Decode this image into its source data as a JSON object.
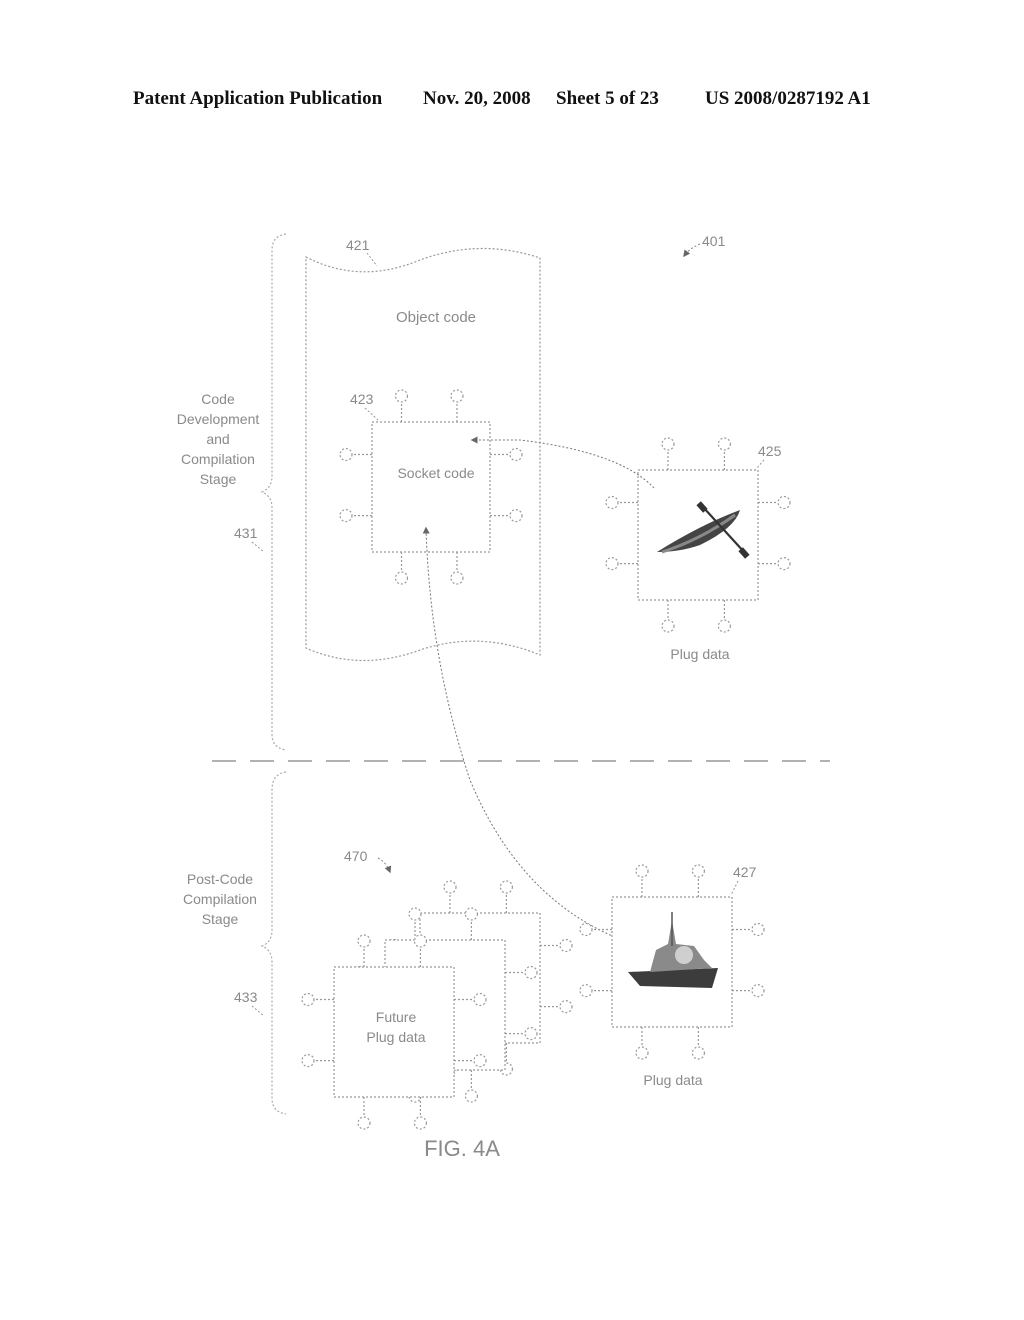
{
  "header": {
    "publication": "Patent Application Publication",
    "date": "Nov. 20, 2008",
    "sheet": "Sheet 5 of 23",
    "number": "US 2008/0287192 A1"
  },
  "figure": {
    "caption": "FIG. 4A",
    "figure_ref": "401",
    "object_code": {
      "ref": "421",
      "label": "Object code"
    },
    "socket_code": {
      "ref": "423",
      "label": "Socket code"
    },
    "plug_top": {
      "ref": "425",
      "label": "Plug data",
      "image": "kayak-icon"
    },
    "plug_bottom": {
      "ref": "427",
      "label": "Plug data",
      "image": "ship-icon"
    },
    "future_plugs": {
      "ref": "470",
      "label_line1": "Future",
      "label_line2": "Plug data"
    },
    "stage_top": {
      "ref": "431",
      "lines": [
        "Code",
        "Development",
        "and",
        "Compilation",
        "Stage"
      ]
    },
    "stage_bottom": {
      "ref": "433",
      "lines": [
        "Post-Code",
        "Compilation",
        "Stage"
      ]
    }
  }
}
